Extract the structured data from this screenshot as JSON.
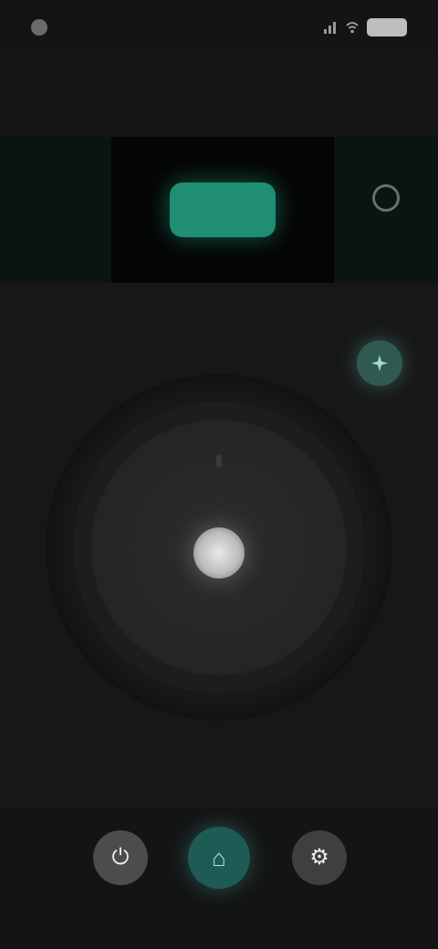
{
  "status_bar": {
    "time": "",
    "battery": ""
  },
  "header": {
    "title": ""
  },
  "mode_panel": {
    "left": {
      "label": "",
      "sub": ""
    },
    "center": {
      "value": ""
    },
    "right": {
      "value": ""
    }
  },
  "dial": {
    "level": null
  },
  "icons": {
    "status_dot": "notification-dot-icon",
    "signal": "signal-icon",
    "wifi": "wifi-icon",
    "battery": "battery-icon",
    "float_button": "sparkle-icon",
    "right_side": "fan-icon",
    "nav_left": "power-icon",
    "nav_center": "home-icon",
    "nav_right": "settings-icon"
  },
  "colors": {
    "accent": "#1f8e73",
    "background": "#171717",
    "nav_center": "#1f5b55"
  },
  "bottom_nav": {
    "left_glyph": "⏻",
    "center_glyph": "⌂",
    "right_glyph": "⚙"
  }
}
